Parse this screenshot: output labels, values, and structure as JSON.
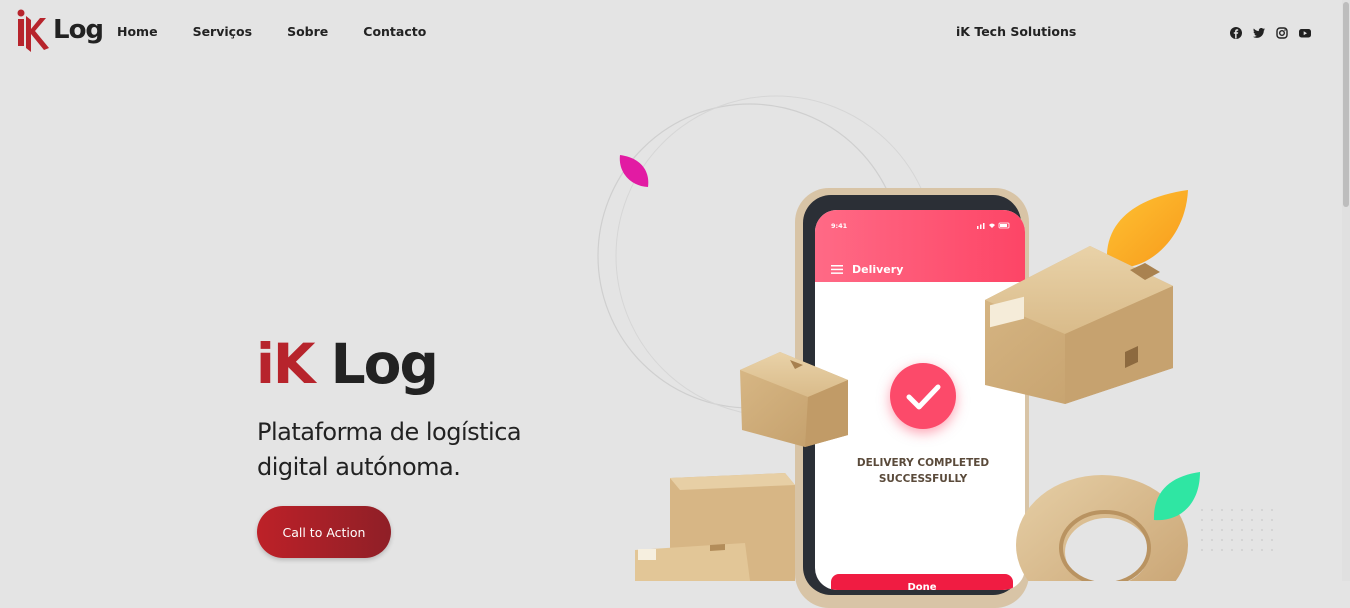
{
  "header": {
    "logo_text": "Log",
    "nav": [
      {
        "label": "Home"
      },
      {
        "label": "Serviços"
      },
      {
        "label": "Sobre"
      },
      {
        "label": "Contacto"
      }
    ],
    "company": "iK Tech Solutions",
    "social_icons": [
      "facebook-icon",
      "twitter-icon",
      "instagram-icon",
      "youtube-icon"
    ]
  },
  "hero": {
    "title_brand": "iK",
    "title_rest": "Log",
    "subtitle": "Plataforma de logística digital autónoma.",
    "cta_label": "Call to Action"
  },
  "phone": {
    "time": "9:41",
    "screen_title": "Delivery",
    "message": "DELIVERY COMPLETED SUCCESSFULLY",
    "button_label": "Done"
  },
  "colors": {
    "brand_red": "#b7242c",
    "phone_pink": "#fd4566",
    "background": "#e4e4e4"
  }
}
